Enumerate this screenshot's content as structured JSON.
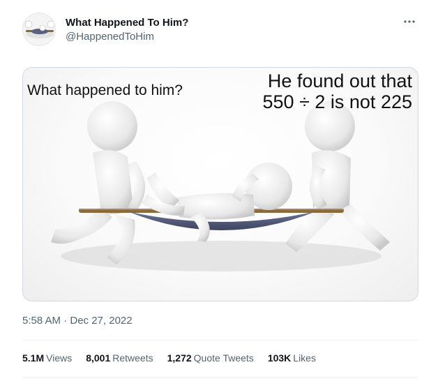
{
  "tweet": {
    "display_name": "What Happened To Him?",
    "handle": "@HappenedToHim",
    "more_icon": "more-horizontal-icon",
    "image": {
      "caption_left": "What happened to him?",
      "caption_right_line1": "He found out that",
      "caption_right_line2": "550 ÷ 2 is not 225"
    },
    "timestamp": "5:58 AM · Dec 27, 2022",
    "stats": [
      {
        "value": "5.1M",
        "label": "Views"
      },
      {
        "value": "8,001",
        "label": "Retweets"
      },
      {
        "value": "1,272",
        "label": "Quote Tweets"
      },
      {
        "value": "103K",
        "label": "Likes"
      }
    ]
  },
  "colors": {
    "text_primary": "#0f1419",
    "text_secondary": "#536471",
    "border": "#cfd9de",
    "divider": "#eff3f4"
  }
}
